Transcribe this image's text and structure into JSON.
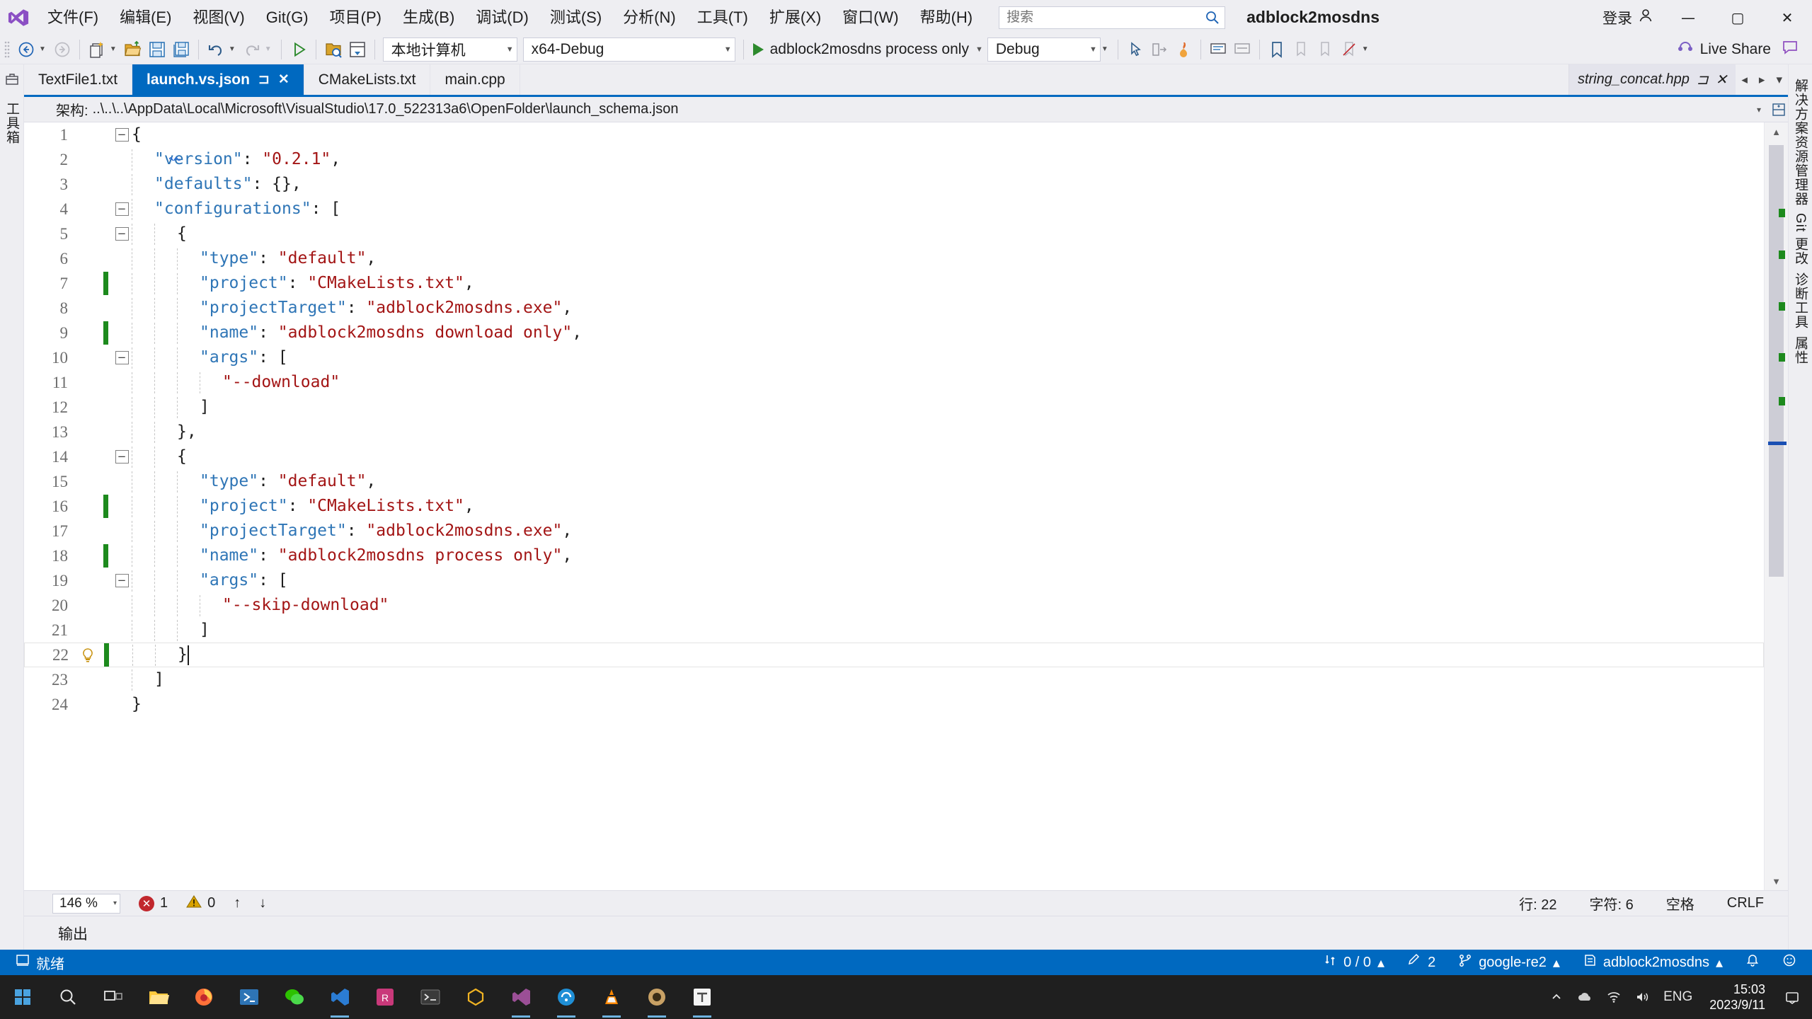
{
  "app": {
    "solution_name": "adblock2mosdns",
    "accent_color": "#0069c0",
    "titlebar_bg": "#eeeef2"
  },
  "menu": {
    "items": [
      {
        "label": "文件(F)",
        "name": "menu-file"
      },
      {
        "label": "编辑(E)",
        "name": "menu-edit"
      },
      {
        "label": "视图(V)",
        "name": "menu-view"
      },
      {
        "label": "Git(G)",
        "name": "menu-git"
      },
      {
        "label": "项目(P)",
        "name": "menu-project"
      },
      {
        "label": "生成(B)",
        "name": "menu-build"
      },
      {
        "label": "调试(D)",
        "name": "menu-debug"
      },
      {
        "label": "测试(S)",
        "name": "menu-test"
      },
      {
        "label": "分析(N)",
        "name": "menu-analyze"
      },
      {
        "label": "工具(T)",
        "name": "menu-tools"
      },
      {
        "label": "扩展(X)",
        "name": "menu-extensions"
      },
      {
        "label": "窗口(W)",
        "name": "menu-window"
      },
      {
        "label": "帮助(H)",
        "name": "menu-help"
      }
    ]
  },
  "search": {
    "placeholder": "搜索",
    "value": "",
    "icon": "search-icon"
  },
  "titlebar_right": {
    "signin_label": "登录",
    "signin_icon": "account-icon",
    "minimize": "—",
    "maximize": "▢",
    "close": "✕"
  },
  "toolbar": {
    "nav_back_icon": "navigate-back-icon",
    "nav_forward_icon": "navigate-forward-icon",
    "new_item_icon": "new-item-icon",
    "open_file_icon": "open-file-icon",
    "save_icon": "save-icon",
    "save_all_icon": "save-all-icon",
    "undo_icon": "undo-icon",
    "redo_icon": "redo-icon",
    "start_icon": "start-debug-icon",
    "folder_search_icon": "folder-search-icon",
    "window_icon": "window-layout-icon",
    "platform_target": "本地计算机",
    "configuration": "x64-Debug",
    "startup_item": "adblock2mosdns process only",
    "debug_config": "Debug",
    "live_share_label": "Live Share",
    "live_share_icon": "live-share-icon",
    "feedback_icon": "feedback-icon",
    "bookmark_icon": "bookmark-icon",
    "comment_icon": "comment-icon",
    "uncomment_icon": "uncomment-icon"
  },
  "left_rail": {
    "items": [
      {
        "label": "工具箱",
        "name": "rail-toolbox",
        "icon": "toolbox-icon"
      }
    ]
  },
  "right_rail": {
    "items": [
      {
        "label": "解决方案资源管理器",
        "name": "rail-solution-explorer",
        "icon": "solution-explorer-icon"
      },
      {
        "label": "Git 更改",
        "name": "rail-git-changes",
        "icon": "git-changes-icon"
      },
      {
        "label": "诊断工具",
        "name": "rail-diagnostic-tools",
        "icon": "diagnostics-icon"
      },
      {
        "label": "属性",
        "name": "rail-properties",
        "icon": "properties-icon"
      }
    ]
  },
  "tabs": {
    "items": [
      {
        "label": "TextFile1.txt",
        "active": false,
        "name": "tab-textfile1"
      },
      {
        "label": "launch.vs.json",
        "active": true,
        "pin_icon": "pin-icon",
        "close_icon": "close-icon",
        "name": "tab-launch-vs-json"
      },
      {
        "label": "CMakeLists.txt",
        "active": false,
        "name": "tab-cmakelists"
      },
      {
        "label": "main.cpp",
        "active": false,
        "name": "tab-main-cpp"
      }
    ],
    "preview_tab": {
      "label": "string_concat.hpp",
      "pin_icon": "pin-icon",
      "close_icon": "close-icon"
    },
    "nav_left": "◂",
    "nav_right": "▸",
    "nav_menu": "▾"
  },
  "schema_bar": {
    "label": "架构:",
    "path": "..\\..\\..\\AppData\\Local\\Microsoft\\VisualStudio\\17.0_522313a6\\OpenFolder\\launch_schema.json",
    "caret": "▾",
    "split_icon": "split-view-icon"
  },
  "editor": {
    "language": "json",
    "total_lines": 24,
    "cursor_line": 22,
    "lines": [
      {
        "n": 1,
        "fold": "minus",
        "change": false,
        "indent": 0,
        "tokens": [
          {
            "t": "{",
            "c": "punct"
          }
        ]
      },
      {
        "n": 2,
        "fold": "",
        "change": false,
        "indent": 1,
        "tokens": [
          {
            "t": "\"version\"",
            "c": "prop"
          },
          {
            "t": ": ",
            "c": "punct"
          },
          {
            "t": "\"0.2.1\"",
            "c": "str"
          },
          {
            "t": ",",
            "c": "punct"
          }
        ]
      },
      {
        "n": 3,
        "fold": "",
        "change": false,
        "indent": 1,
        "tokens": [
          {
            "t": "\"defaults\"",
            "c": "prop"
          },
          {
            "t": ": {},",
            "c": "punct"
          }
        ]
      },
      {
        "n": 4,
        "fold": "minus",
        "change": false,
        "indent": 1,
        "tokens": [
          {
            "t": "\"configurations\"",
            "c": "prop"
          },
          {
            "t": ": [",
            "c": "punct"
          }
        ]
      },
      {
        "n": 5,
        "fold": "minus",
        "change": false,
        "indent": 2,
        "tokens": [
          {
            "t": "{",
            "c": "punct"
          }
        ]
      },
      {
        "n": 6,
        "fold": "",
        "change": false,
        "indent": 3,
        "tokens": [
          {
            "t": "\"type\"",
            "c": "prop"
          },
          {
            "t": ": ",
            "c": "punct"
          },
          {
            "t": "\"default\"",
            "c": "str"
          },
          {
            "t": ",",
            "c": "punct"
          }
        ]
      },
      {
        "n": 7,
        "fold": "",
        "change": true,
        "indent": 3,
        "tokens": [
          {
            "t": "\"project\"",
            "c": "prop"
          },
          {
            "t": ": ",
            "c": "punct"
          },
          {
            "t": "\"CMakeLists.txt\"",
            "c": "str"
          },
          {
            "t": ",",
            "c": "punct"
          }
        ]
      },
      {
        "n": 8,
        "fold": "",
        "change": false,
        "indent": 3,
        "tokens": [
          {
            "t": "\"projectTarget\"",
            "c": "prop"
          },
          {
            "t": ": ",
            "c": "punct"
          },
          {
            "t": "\"adblock2mosdns.exe\"",
            "c": "str"
          },
          {
            "t": ",",
            "c": "punct"
          }
        ]
      },
      {
        "n": 9,
        "fold": "",
        "change": true,
        "indent": 3,
        "tokens": [
          {
            "t": "\"name\"",
            "c": "prop"
          },
          {
            "t": ": ",
            "c": "punct"
          },
          {
            "t": "\"adblock2mosdns download only\"",
            "c": "str"
          },
          {
            "t": ",",
            "c": "punct"
          }
        ]
      },
      {
        "n": 10,
        "fold": "minus",
        "change": false,
        "indent": 3,
        "tokens": [
          {
            "t": "\"args\"",
            "c": "prop"
          },
          {
            "t": ": [",
            "c": "punct"
          }
        ]
      },
      {
        "n": 11,
        "fold": "",
        "change": false,
        "indent": 4,
        "tokens": [
          {
            "t": "\"--download\"",
            "c": "str"
          }
        ]
      },
      {
        "n": 12,
        "fold": "",
        "change": false,
        "indent": 3,
        "tokens": [
          {
            "t": "]",
            "c": "punct"
          }
        ]
      },
      {
        "n": 13,
        "fold": "",
        "change": false,
        "indent": 2,
        "tokens": [
          {
            "t": "},",
            "c": "punct"
          }
        ]
      },
      {
        "n": 14,
        "fold": "minus",
        "change": false,
        "indent": 2,
        "tokens": [
          {
            "t": "{",
            "c": "punct"
          }
        ]
      },
      {
        "n": 15,
        "fold": "",
        "change": false,
        "indent": 3,
        "tokens": [
          {
            "t": "\"type\"",
            "c": "prop"
          },
          {
            "t": ": ",
            "c": "punct"
          },
          {
            "t": "\"default\"",
            "c": "str"
          },
          {
            "t": ",",
            "c": "punct"
          }
        ]
      },
      {
        "n": 16,
        "fold": "",
        "change": true,
        "indent": 3,
        "tokens": [
          {
            "t": "\"project\"",
            "c": "prop"
          },
          {
            "t": ": ",
            "c": "punct"
          },
          {
            "t": "\"CMakeLists.txt\"",
            "c": "str"
          },
          {
            "t": ",",
            "c": "punct"
          }
        ]
      },
      {
        "n": 17,
        "fold": "",
        "change": false,
        "indent": 3,
        "tokens": [
          {
            "t": "\"projectTarget\"",
            "c": "prop"
          },
          {
            "t": ": ",
            "c": "punct"
          },
          {
            "t": "\"adblock2mosdns.exe\"",
            "c": "str"
          },
          {
            "t": ",",
            "c": "punct"
          }
        ]
      },
      {
        "n": 18,
        "fold": "",
        "change": true,
        "indent": 3,
        "tokens": [
          {
            "t": "\"name\"",
            "c": "prop"
          },
          {
            "t": ": ",
            "c": "punct"
          },
          {
            "t": "\"adblock2mosdns process only\"",
            "c": "str"
          },
          {
            "t": ",",
            "c": "punct"
          }
        ]
      },
      {
        "n": 19,
        "fold": "minus",
        "change": false,
        "indent": 3,
        "tokens": [
          {
            "t": "\"args\"",
            "c": "prop"
          },
          {
            "t": ": [",
            "c": "punct"
          }
        ]
      },
      {
        "n": 20,
        "fold": "",
        "change": false,
        "indent": 4,
        "tokens": [
          {
            "t": "\"--skip-download\"",
            "c": "str"
          }
        ]
      },
      {
        "n": 21,
        "fold": "",
        "change": false,
        "indent": 3,
        "tokens": [
          {
            "t": "]",
            "c": "punct"
          }
        ]
      },
      {
        "n": 22,
        "fold": "",
        "change": true,
        "indent": 2,
        "cursor": true,
        "bulb": true,
        "tokens": [
          {
            "t": "}",
            "c": "punct"
          }
        ]
      },
      {
        "n": 23,
        "fold": "",
        "change": false,
        "indent": 1,
        "tokens": [
          {
            "t": "]",
            "c": "punct"
          }
        ]
      },
      {
        "n": 24,
        "fold": "",
        "change": false,
        "indent": 0,
        "tokens": [
          {
            "t": "}",
            "c": "punct"
          }
        ]
      }
    ]
  },
  "editor_status": {
    "zoom": "146 %",
    "zoom_caret": "▾",
    "error_count": "1",
    "warning_count": "0",
    "nav_up": "↑",
    "nav_down": "↓",
    "line_label": "行: 22",
    "col_label": "字符: 6",
    "insert_mode": "空格",
    "line_ending": "CRLF"
  },
  "output_panel": {
    "title": "输出"
  },
  "status_bar": {
    "ready_icon": "ready-icon",
    "ready_label": "就绪",
    "changes_icon": "source-control-icon",
    "changes_label": "0 / 0",
    "changes_caret": "▴",
    "pending_icon": "pencil-icon",
    "pending_count": "2",
    "branch_icon": "branch-icon",
    "branch_label": "google-re2",
    "branch_caret": "▴",
    "repo_icon": "repo-icon",
    "repo_label": "adblock2mosdns",
    "repo_caret": "▴",
    "notification_icon": "bell-icon",
    "feedback_icon": "feedback-smiley-icon"
  },
  "taskbar": {
    "start_icon": "windows-start-icon",
    "search_icon": "taskbar-search-icon",
    "taskview_icon": "task-view-icon",
    "apps": [
      {
        "name": "file-explorer-icon",
        "label": "文件资源管理器",
        "running": false,
        "color": "#ffc83d"
      },
      {
        "name": "firefox-icon",
        "label": "Firefox",
        "running": false,
        "color": "#ff7139"
      },
      {
        "name": "powershell-icon",
        "label": "PowerShell",
        "running": false,
        "color": "#2e74b5"
      },
      {
        "name": "wechat-icon",
        "label": "WeChat",
        "running": false,
        "color": "#2dc100"
      },
      {
        "name": "vscode-icon",
        "label": "Visual Studio Code",
        "running": true,
        "color": "#2b7cd3"
      },
      {
        "name": "rider-icon",
        "label": "Rider",
        "running": false,
        "color": "#c9397a"
      },
      {
        "name": "terminal-icon",
        "label": "Windows Terminal",
        "running": false,
        "color": "#1f1f1f"
      },
      {
        "name": "unity-icon",
        "label": "Unity",
        "running": false,
        "color": "#f0b323"
      },
      {
        "name": "visual-studio-icon",
        "label": "Visual Studio",
        "running": true,
        "color": "#9b4f96"
      },
      {
        "name": "clash-icon",
        "label": "Clash",
        "running": true,
        "color": "#1f8fd6"
      },
      {
        "name": "vlc-icon",
        "label": "VLC",
        "running": true,
        "color": "#ff8800"
      },
      {
        "name": "obs-icon",
        "label": "OBS",
        "running": true,
        "color": "#c8a165"
      },
      {
        "name": "typora-icon",
        "label": "Typora",
        "running": true,
        "color": "#4d4d4d"
      }
    ],
    "tray": {
      "chevron_icon": "show-hidden-icons-icon",
      "cloud_icon": "onedrive-icon",
      "network_icon": "network-icon",
      "volume_icon": "volume-icon",
      "ime_label": "ENG",
      "time": "15:03",
      "date": "2023/9/11",
      "action_center_icon": "action-center-icon"
    }
  }
}
